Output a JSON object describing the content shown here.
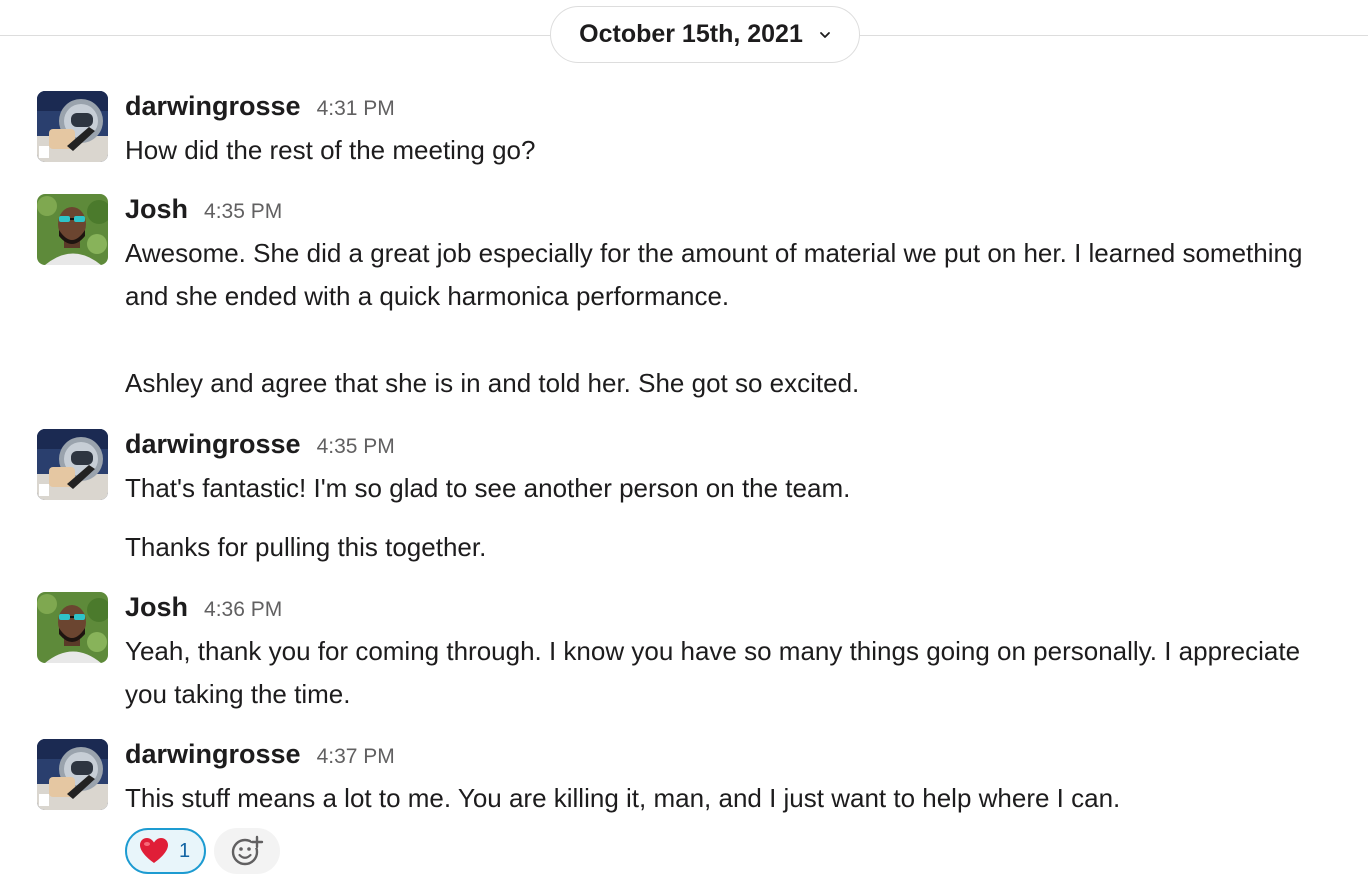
{
  "date_divider": {
    "label": "October 15th, 2021"
  },
  "messages": [
    {
      "user": "darwingrosse",
      "time": "4:31 PM",
      "paragraphs": [
        "How did the rest of the meeting go?"
      ]
    },
    {
      "user": "Josh",
      "time": "4:35 PM",
      "paragraphs": [
        "Awesome. She did a great job especially for the amount of material we put on her. I learned something and she ended with a quick harmonica performance.",
        "Ashley and agree that she is in and told her. She got so excited."
      ]
    },
    {
      "user": "darwingrosse",
      "time": "4:35 PM",
      "paragraphs": [
        "That's fantastic! I'm so glad to see another person on the team.",
        "Thanks for pulling this together."
      ]
    },
    {
      "user": "Josh",
      "time": "4:36 PM",
      "paragraphs": [
        "Yeah, thank you for coming through. I know you have so many things going on personally. I appreciate you taking the time."
      ]
    },
    {
      "user": "darwingrosse",
      "time": "4:37 PM",
      "paragraphs": [
        "This stuff means a lot to me. You are killing it, man, and I just want to help where I can."
      ],
      "reactions": [
        {
          "emoji": "heart-icon",
          "count": "1"
        }
      ]
    }
  ],
  "colors": {
    "text": "#1d1c1d",
    "timestamp": "#616061",
    "reaction_border": "#1d9bd1",
    "reaction_bg": "#e8f5fa",
    "reaction_count": "#1264a3",
    "heart": "#e01e37"
  }
}
